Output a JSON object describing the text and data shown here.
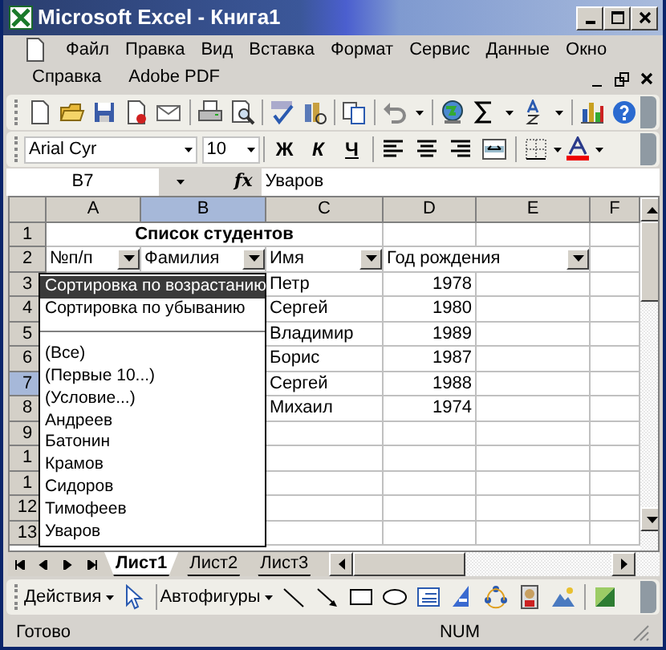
{
  "window": {
    "title": "Microsoft Excel - Книга1"
  },
  "menu": [
    {
      "label": "Файл"
    },
    {
      "label": "Правка"
    },
    {
      "label": "Вид"
    },
    {
      "label": "Вставка"
    },
    {
      "label": "Формат"
    },
    {
      "label": "Сервис"
    },
    {
      "label": "Данные"
    },
    {
      "label": "Окно"
    },
    {
      "label": "Справка"
    },
    {
      "label": "Adobe PDF"
    }
  ],
  "font_toolbar": {
    "font": "Arial Cyr",
    "size": "10",
    "format_buttons": [
      {
        "kind": "bold",
        "label": "Ж"
      },
      {
        "kind": "italic",
        "label": "К"
      },
      {
        "kind": "underline",
        "label": "Ч"
      }
    ]
  },
  "formula_bar": {
    "name_box": "B7",
    "fx": "fx",
    "value": "Уваров"
  },
  "sheet": {
    "columns": [
      {
        "label": "A",
        "selected": false
      },
      {
        "label": "B",
        "selected": true
      },
      {
        "label": "C",
        "selected": false
      },
      {
        "label": "D",
        "selected": false
      },
      {
        "label": "E",
        "selected": false
      },
      {
        "label": "F",
        "selected": false
      }
    ],
    "rows": [
      {
        "number": "1",
        "selected": false,
        "kind": "title",
        "title": "Список студентов"
      },
      {
        "number": "2",
        "selected": false,
        "kind": "header",
        "filters": [
          "№п/п",
          "Фамилия",
          "Имя",
          "Год рождения"
        ]
      },
      {
        "number": "3",
        "selected": false,
        "kind": "data",
        "cells": {
          "C": "Петр",
          "D": "1978"
        }
      },
      {
        "number": "4",
        "selected": false,
        "kind": "data",
        "cells": {
          "C": "Сергей",
          "D": "1980"
        }
      },
      {
        "number": "5",
        "selected": false,
        "kind": "data",
        "cells": {
          "C": "Владимир",
          "D": "1989"
        }
      },
      {
        "number": "6",
        "selected": false,
        "kind": "data",
        "cells": {
          "C": "Борис",
          "D": "1987"
        }
      },
      {
        "number": "7",
        "selected": true,
        "kind": "data",
        "cells": {
          "C": "Сергей",
          "D": "1988"
        }
      },
      {
        "number": "8",
        "selected": false,
        "kind": "data",
        "cells": {
          "C": "Михаил",
          "D": "1974"
        }
      },
      {
        "number": "9",
        "selected": false,
        "kind": "data",
        "cells": {}
      },
      {
        "number": "1",
        "selected": false,
        "kind": "data",
        "cells": {}
      },
      {
        "number": "1",
        "selected": false,
        "kind": "data",
        "cells": {}
      },
      {
        "number": "12",
        "selected": false,
        "kind": "data",
        "cells": {}
      },
      {
        "number": "13",
        "selected": false,
        "kind": "data",
        "cells": {}
      }
    ],
    "filter_menu": {
      "sort_options": [
        {
          "label": "Сортировка по возрастанию",
          "selected": true
        },
        {
          "label": "Сортировка по убыванию",
          "selected": false
        }
      ],
      "values": [
        {
          "label": "(Все)",
          "selected": false
        },
        {
          "label": "(Первые 10...)",
          "selected": false
        },
        {
          "label": "(Условие...)",
          "selected": false
        },
        {
          "label": "Андреев",
          "selected": false
        },
        {
          "label": "Батонин",
          "selected": false
        },
        {
          "label": "Крамов",
          "selected": false
        },
        {
          "label": "Сидоров",
          "selected": false
        },
        {
          "label": "Тимофеев",
          "selected": false
        },
        {
          "label": "Уваров",
          "selected": false
        }
      ]
    }
  },
  "sheet_tabs": [
    {
      "label": "Лист1",
      "selected": true
    },
    {
      "label": "Лист2",
      "selected": false
    },
    {
      "label": "Лист3",
      "selected": false
    }
  ],
  "drawing_toolbar": {
    "actions": "Действия",
    "autoshapes": "Автофигуры"
  },
  "status_bar": {
    "status": "Готово",
    "num": "NUM"
  }
}
